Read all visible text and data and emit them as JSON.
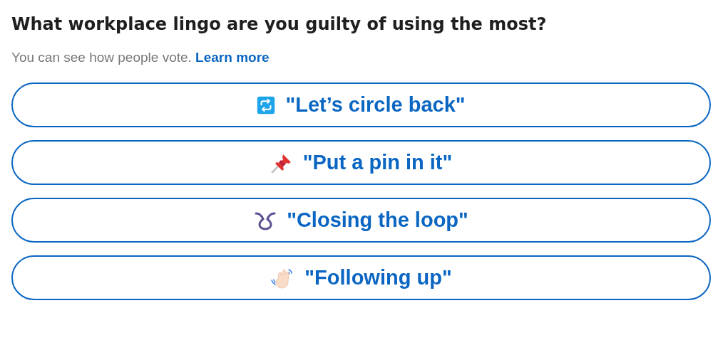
{
  "question": "What workplace lingo are you guilty of using the most?",
  "note": {
    "text": "You can see how people vote.",
    "link": "Learn more"
  },
  "options": [
    {
      "kind": "repeat",
      "label": "\"Let’s circle back\""
    },
    {
      "kind": "pin",
      "label": "\"Put a pin in it\""
    },
    {
      "kind": "loop",
      "label": "\"Closing the loop\""
    },
    {
      "kind": "wave",
      "label": "\"Following up\""
    }
  ]
}
